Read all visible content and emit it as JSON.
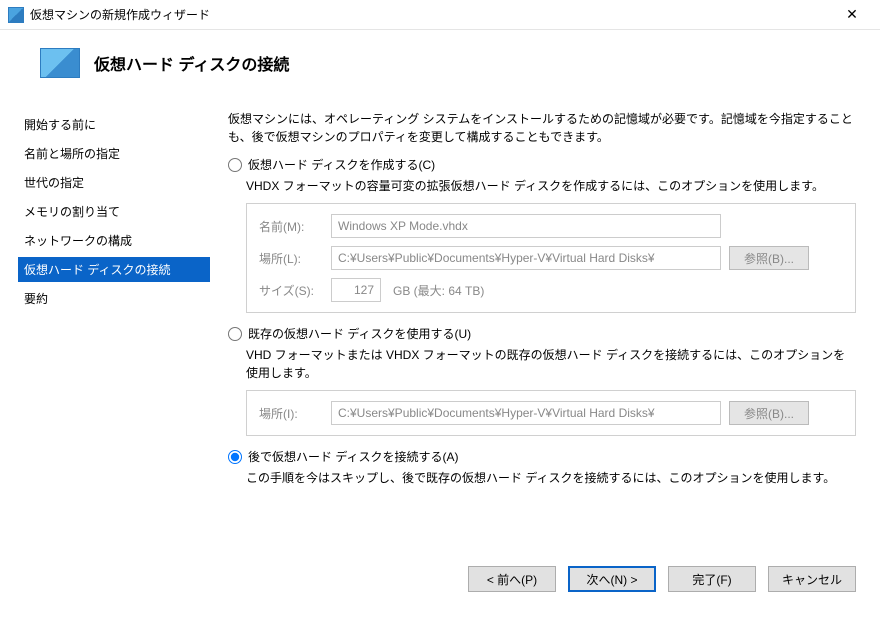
{
  "window": {
    "title": "仮想マシンの新規作成ウィザード"
  },
  "header": {
    "title": "仮想ハード ディスクの接続"
  },
  "sidebar": {
    "steps": [
      "開始する前に",
      "名前と場所の指定",
      "世代の指定",
      "メモリの割り当て",
      "ネットワークの構成",
      "仮想ハード ディスクの接続",
      "要約"
    ],
    "activeIndex": 5
  },
  "main": {
    "intro": "仮想マシンには、オペレーティング システムをインストールするための記憶域が必要です。記憶域を今指定することも、後で仮想マシンのプロパティを変更して構成することもできます。",
    "opt1": {
      "label": "仮想ハード ディスクを作成する(C)",
      "desc": "VHDX フォーマットの容量可変の拡張仮想ハード ディスクを作成するには、このオプションを使用します。",
      "nameLabel": "名前(M):",
      "nameValue": "Windows XP Mode.vhdx",
      "locLabel": "場所(L):",
      "locValue": "C:¥Users¥Public¥Documents¥Hyper-V¥Virtual Hard Disks¥",
      "browse": "参照(B)...",
      "sizeLabel": "サイズ(S):",
      "sizeValue": "127",
      "sizeHint": "GB (最大: 64 TB)"
    },
    "opt2": {
      "label": "既存の仮想ハード ディスクを使用する(U)",
      "desc": "VHD フォーマットまたは VHDX フォーマットの既存の仮想ハード ディスクを接続するには、このオプションを使用します。",
      "locLabel": "場所(I):",
      "locValue": "C:¥Users¥Public¥Documents¥Hyper-V¥Virtual Hard Disks¥",
      "browse": "参照(B)..."
    },
    "opt3": {
      "label": "後で仮想ハード ディスクを接続する(A)",
      "desc": "この手順を今はスキップし、後で既存の仮想ハード ディスクを接続するには、このオプションを使用します。"
    }
  },
  "footer": {
    "prev": "< 前へ(P)",
    "next": "次へ(N) >",
    "finish": "完了(F)",
    "cancel": "キャンセル"
  }
}
